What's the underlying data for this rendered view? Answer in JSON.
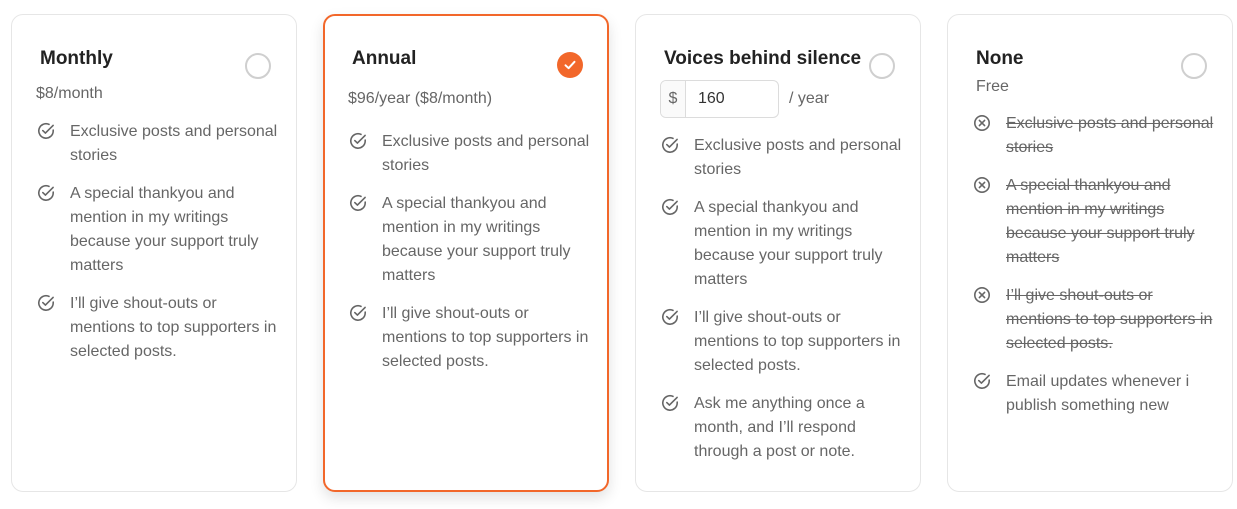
{
  "colors": {
    "accent": "#f2672a",
    "border": "#e6e6e6",
    "text_muted": "#666666"
  },
  "plans": [
    {
      "title": "Monthly",
      "price": "$8/month",
      "selected": false,
      "features": [
        {
          "text": "Exclusive posts and personal stories",
          "included": true,
          "icon": "check-circle-icon"
        },
        {
          "text": "A special thankyou and mention in my writings because your support truly matters",
          "included": true,
          "icon": "check-circle-icon"
        },
        {
          "text": "I’ll give shout-outs or mentions to top supporters in selected posts.",
          "included": true,
          "icon": "check-circle-icon"
        }
      ]
    },
    {
      "title": "Annual",
      "price": "$96/year ($8/month)",
      "selected": true,
      "features": [
        {
          "text": "Exclusive posts and personal stories",
          "included": true,
          "icon": "check-circle-icon"
        },
        {
          "text": "A special thankyou and mention in my writings because your support truly matters",
          "included": true,
          "icon": "check-circle-icon"
        },
        {
          "text": "I’ll give shout-outs or mentions to top supporters in selected posts.",
          "included": true,
          "icon": "check-circle-icon"
        }
      ]
    },
    {
      "title": "Voices behind silence",
      "currency_symbol": "$",
      "amount": "160",
      "per_label": "/ year",
      "selected": false,
      "features": [
        {
          "text": "Exclusive posts and personal stories",
          "included": true,
          "icon": "check-circle-icon"
        },
        {
          "text": "A special thankyou and mention in my writings because your support truly matters",
          "included": true,
          "icon": "check-circle-icon"
        },
        {
          "text": "I’ll give shout-outs or mentions to top supporters in selected posts.",
          "included": true,
          "icon": "check-circle-icon"
        },
        {
          "text": "Ask me anything once a month, and I’ll respond through a post or note.",
          "included": true,
          "icon": "check-circle-icon"
        }
      ]
    },
    {
      "title": "None",
      "price": "Free",
      "selected": false,
      "features": [
        {
          "text": "Exclusive posts and personal stories",
          "included": false,
          "icon": "x-circle-icon"
        },
        {
          "text": "A special thankyou and mention in my writings because your support truly matters",
          "included": false,
          "icon": "x-circle-icon"
        },
        {
          "text": "I’ll give shout-outs or mentions to top supporters in selected posts.",
          "included": false,
          "icon": "x-circle-icon"
        },
        {
          "text": "Email updates whenever i publish something new",
          "included": true,
          "icon": "check-circle-icon"
        }
      ]
    }
  ]
}
